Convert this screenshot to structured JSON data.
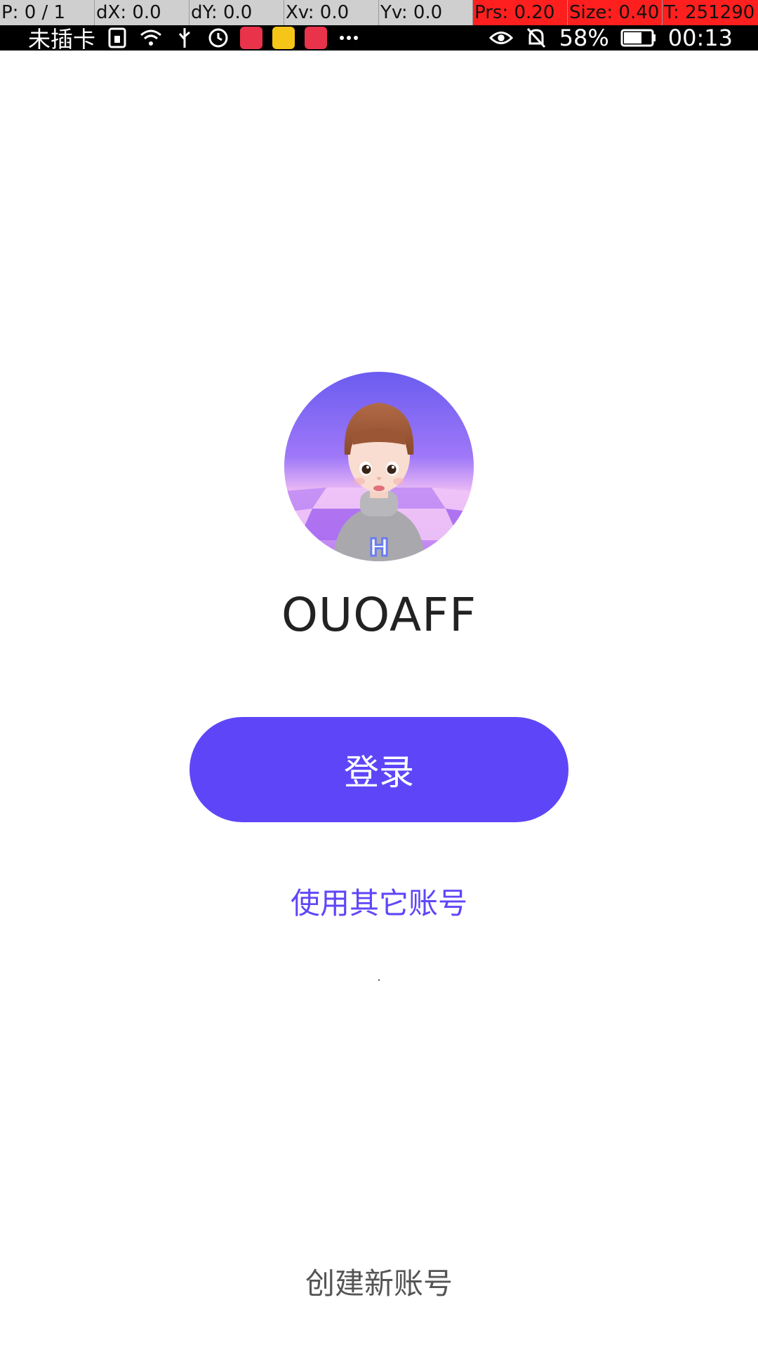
{
  "status_bar": {
    "carrier": "未插卡",
    "battery": "58%",
    "time": "00:13"
  },
  "debug_overlay": {
    "pointer": "P: 0 / 1",
    "dx": "dX: 0.0",
    "dy": "dY: 0.0",
    "xv": "Xv: 0.0",
    "yv": "Yv: 0.0",
    "prs": "Prs: 0.20",
    "size": "Size: 0.40",
    "t": "T: 251290"
  },
  "account": {
    "username": "OUOAFF",
    "avatar_badge_letter": "H"
  },
  "actions": {
    "login_label": "登录",
    "other_account_label": "使用其它账号",
    "create_account_label": "创建新账号"
  },
  "colors": {
    "accent": "#5e46f8",
    "text_primary": "#222222",
    "text_secondary": "#555555"
  }
}
